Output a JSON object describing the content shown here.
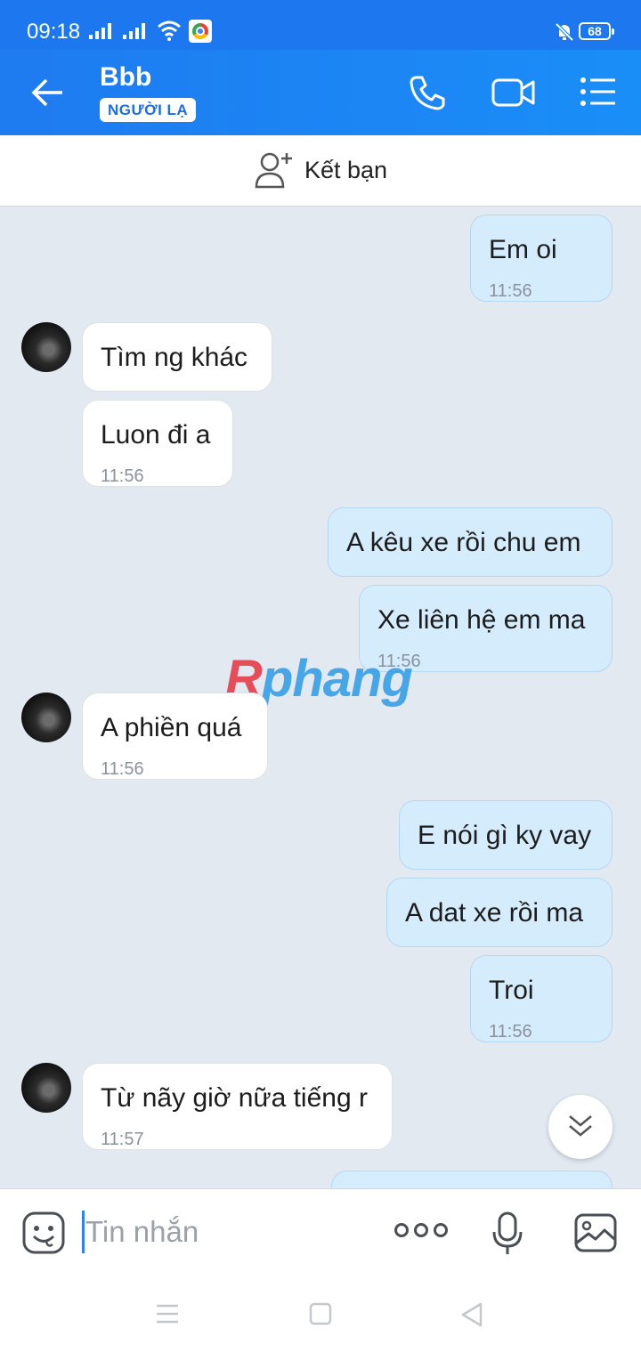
{
  "status_bar": {
    "time": "09:18",
    "battery": "68"
  },
  "header": {
    "contact_name": "Bbb",
    "badge": "NGƯỜI LẠ"
  },
  "friend_bar": {
    "label": "Kết bạn"
  },
  "messages": [
    {
      "dir": "out",
      "text": "Em oi",
      "time": "11:56"
    },
    {
      "dir": "in",
      "text": "Tìm ng khác",
      "time": ""
    },
    {
      "dir": "in",
      "text": "Luon đi a",
      "time": "11:56"
    },
    {
      "dir": "out",
      "text": "A kêu xe rồi chu em",
      "time": ""
    },
    {
      "dir": "out",
      "text": "Xe liên hệ em ma",
      "time": "11:56"
    },
    {
      "dir": "in",
      "text": "A phiền quá",
      "time": "11:56"
    },
    {
      "dir": "out",
      "text": "E nói gì ky vay",
      "time": ""
    },
    {
      "dir": "out",
      "text": "A dat xe rồi ma",
      "time": ""
    },
    {
      "dir": "out",
      "text": "Troi",
      "time": "11:56"
    },
    {
      "dir": "in",
      "text": "Từ nãy giờ nữa tiếng r",
      "time": "11:57"
    }
  ],
  "watermark": {
    "r": "R",
    "rest": "phang"
  },
  "input": {
    "placeholder": "Tin nhắn"
  },
  "icons": {
    "back": "back-arrow-icon",
    "call": "phone-icon",
    "video": "video-camera-icon",
    "menu": "list-menu-icon",
    "add_friend": "add-user-icon",
    "emoji": "emoji-icon",
    "more": "more-dots-icon",
    "mic": "microphone-icon",
    "gallery": "image-icon",
    "scroll_down": "chevron-double-down-icon"
  },
  "colors": {
    "header": "#1e7bf0",
    "out_bubble": "#d5ecfd",
    "in_bubble": "#ffffff",
    "chat_bg": "#e2e9f1"
  }
}
